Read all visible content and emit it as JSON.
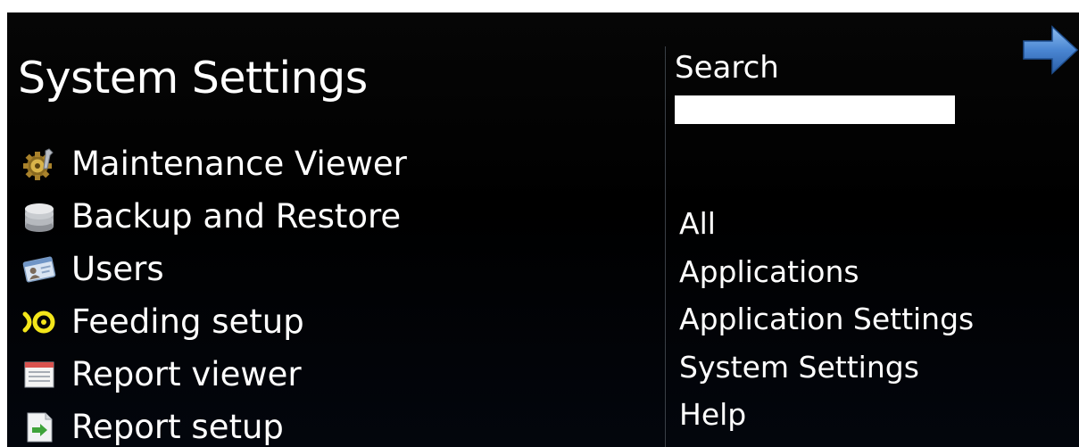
{
  "header": {
    "title": "System Settings"
  },
  "menu": {
    "items": [
      {
        "label": "Maintenance Viewer",
        "icon": "gear-wrench-icon"
      },
      {
        "label": "Backup and Restore",
        "icon": "database-icon"
      },
      {
        "label": "Users",
        "icon": "user-card-icon"
      },
      {
        "label": "Feeding setup",
        "icon": "feeding-icon"
      },
      {
        "label": "Report viewer",
        "icon": "report-window-icon"
      },
      {
        "label": "Report setup",
        "icon": "report-setup-icon"
      }
    ]
  },
  "search": {
    "label": "Search",
    "value": "",
    "placeholder": ""
  },
  "filters": {
    "items": [
      "All",
      "Applications",
      "Application Settings",
      "System Settings",
      "Help"
    ]
  },
  "navigation": {
    "forward_icon": "arrow-right-icon"
  },
  "colors": {
    "background": "#000000",
    "text": "#ffffff",
    "arrow": "#4a86d2",
    "feeding_icon": "#f3e61a"
  }
}
